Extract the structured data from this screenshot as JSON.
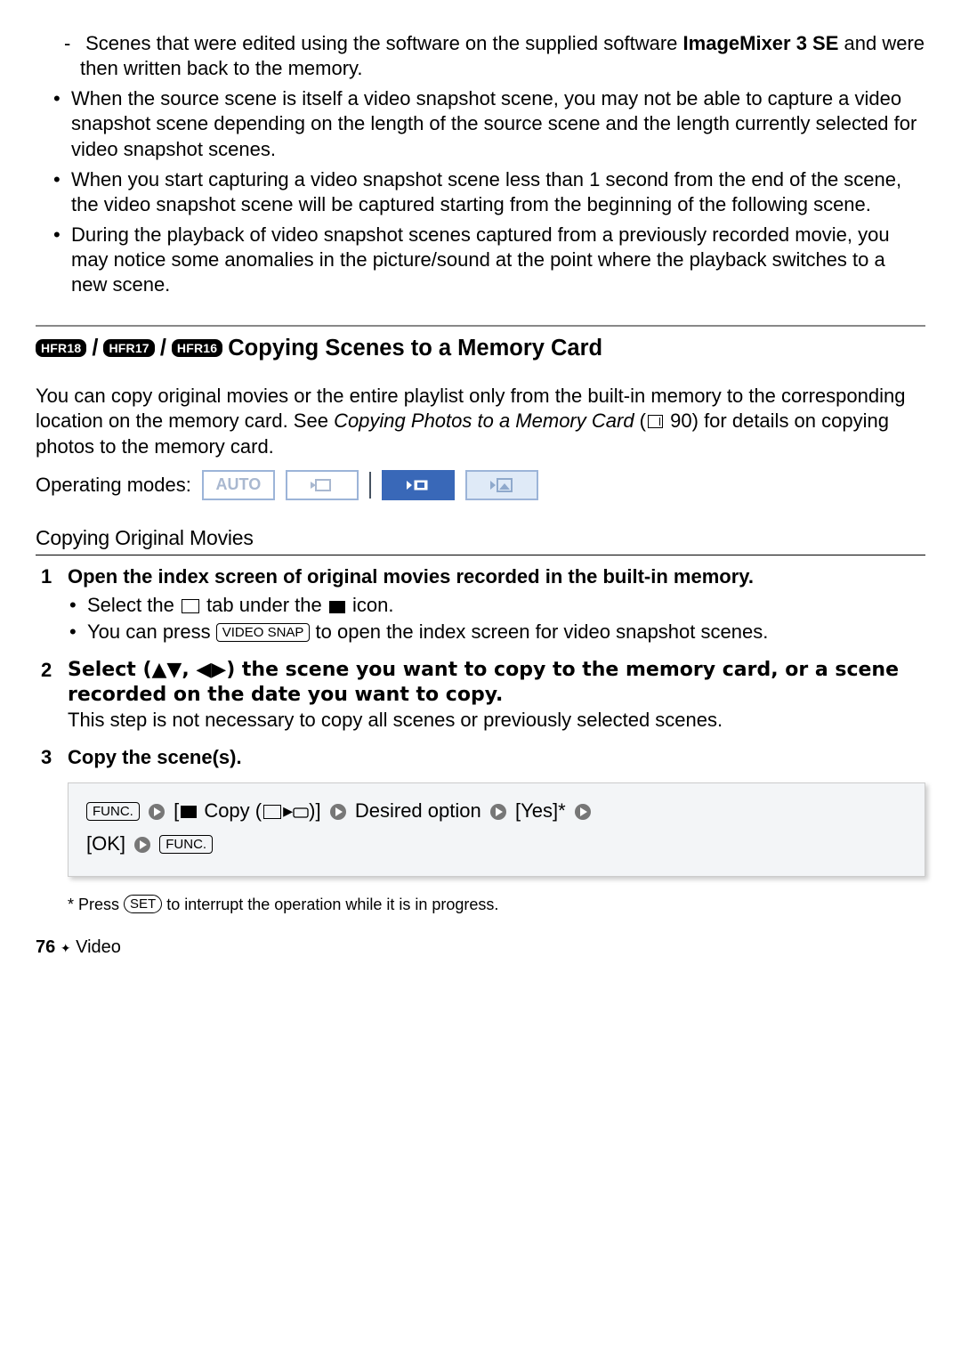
{
  "topSection": {
    "dashItem": {
      "prefix": "Scenes that were edited using the software on the supplied software ",
      "bold": "ImageMixer 3 SE",
      "suffix": " and were then written back to the memory."
    },
    "bullets": [
      "When the source scene is itself a video snapshot scene, you may not be able to capture a video snapshot scene depending on the length of the source scene and the length currently selected for video snapshot scenes.",
      "When you start capturing a video snapshot scene less than 1 second from the end of the scene, the video snapshot scene will be captured starting from the beginning of the following scene.",
      "During the playback of video snapshot scenes captured from a previously recorded movie, you may notice some anomalies in the picture/sound at the point where the playback switches to a new scene."
    ]
  },
  "sectionHeader": {
    "badges": [
      "HFR18",
      "HFR17",
      "HFR16"
    ],
    "title": "Copying Scenes to a Memory Card"
  },
  "intro": {
    "part1": "You can copy original movies or the entire playlist only from the built-in memory to the corresponding location on the memory card. See ",
    "italic": "Copying Photos to a Memory Card",
    "part2": " (",
    "pageRef": "90",
    "part3": ") for details on copying photos to the memory card."
  },
  "operatingModes": {
    "label": "Operating modes:",
    "auto": "AUTO"
  },
  "subheading": "Copying Original Movies",
  "steps": {
    "s1": {
      "title": "Open the index screen of original movies recorded in the built-in memory.",
      "b1a": "Select the ",
      "b1b": " tab under the ",
      "b1c": " icon.",
      "b2a": "You can press ",
      "b2btn": "VIDEO SNAP",
      "b2b": " to open the index screen for video snapshot scenes."
    },
    "s2": {
      "title": "Select (▲▼, ◀▶) the scene you want to copy to the memory card, or a scene recorded on the date you want to copy.",
      "body": "This step is not necessary to copy all scenes or previously selected scenes."
    },
    "s3": {
      "title": "Copy the scene(s)."
    }
  },
  "instructionBox": {
    "func": "FUNC.",
    "copyLabel": "Copy",
    "desired": "Desired option",
    "yes": "[Yes]*",
    "ok": "[OK]"
  },
  "footnote": {
    "prefix": "* Press ",
    "btn": "SET",
    "suffix": " to interrupt the operation while it is in progress."
  },
  "footer": {
    "page": "76",
    "diamond": "✦",
    "section": "Video"
  }
}
